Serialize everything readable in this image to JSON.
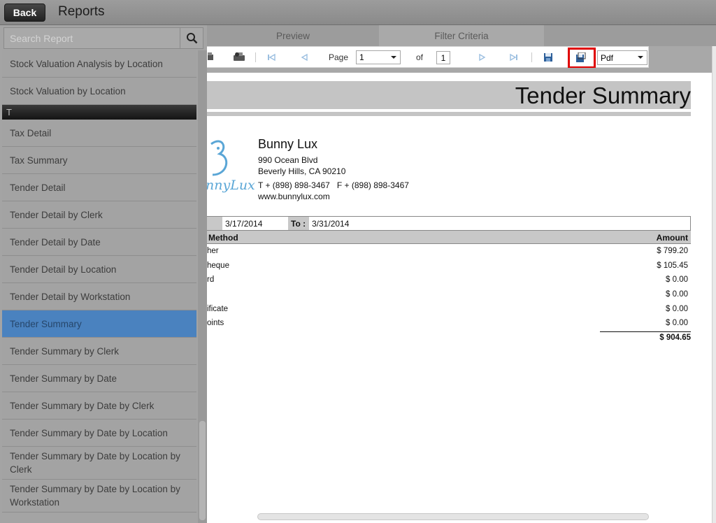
{
  "header": {
    "back_label": "Back",
    "title": "Reports"
  },
  "search": {
    "placeholder": "Search Report"
  },
  "sidebar": {
    "items_before": [
      {
        "label": "Stock Valuation Analysis by Location"
      },
      {
        "label": "Stock Valuation by Location"
      }
    ],
    "section": "T",
    "items": [
      {
        "label": "Tax Detail"
      },
      {
        "label": "Tax Summary"
      },
      {
        "label": "Tender Detail"
      },
      {
        "label": "Tender Detail by Clerk"
      },
      {
        "label": "Tender Detail by Date"
      },
      {
        "label": "Tender Detail by Location"
      },
      {
        "label": "Tender Detail by Workstation"
      },
      {
        "label": "Tender Summary"
      },
      {
        "label": "Tender Summary by Clerk"
      },
      {
        "label": "Tender Summary by Date"
      },
      {
        "label": "Tender Summary by Date by Clerk"
      },
      {
        "label": "Tender Summary by Date by Location"
      },
      {
        "label": "Tender Summary by Date by Location by Clerk"
      },
      {
        "label": "Tender Summary by Date by Location by Workstation"
      }
    ],
    "active_item": "Tender Summary"
  },
  "tabs": {
    "preview": "Preview",
    "filter": "Filter Criteria"
  },
  "toolbar": {
    "page_label": "Page",
    "page_value": "1",
    "of_label": "of",
    "total_pages": "1",
    "export_format": "Pdf"
  },
  "report": {
    "title": "Tender Summary",
    "company": {
      "name": "Bunny Lux",
      "address1": "990 Ocean Blvd",
      "address2": "Beverly Hills, CA 90210",
      "phones": "T + (898) 898-3467   F + (898) 898-3467",
      "website": "www.bunnylux.com"
    },
    "logo_text": "nnyLux",
    "from_date": "3/17/2014",
    "to_label": "To :",
    "to_date": "3/31/2014",
    "columns": {
      "method": "Method",
      "amount": "Amount"
    },
    "rows": [
      {
        "method": "her",
        "amount": "$ 799.20"
      },
      {
        "method": "heque",
        "amount": "$ 105.45"
      },
      {
        "method": "rd",
        "amount": "$ 0.00"
      },
      {
        "method": "",
        "amount": "$ 0.00"
      },
      {
        "method": "ificate",
        "amount": "$ 0.00"
      },
      {
        "method": "oints",
        "amount": "$ 0.00"
      }
    ],
    "total": "$ 904.65"
  },
  "colors": {
    "active_item": "#4a82bf",
    "highlight": "#e00000",
    "logo": "#5aa6d6"
  }
}
